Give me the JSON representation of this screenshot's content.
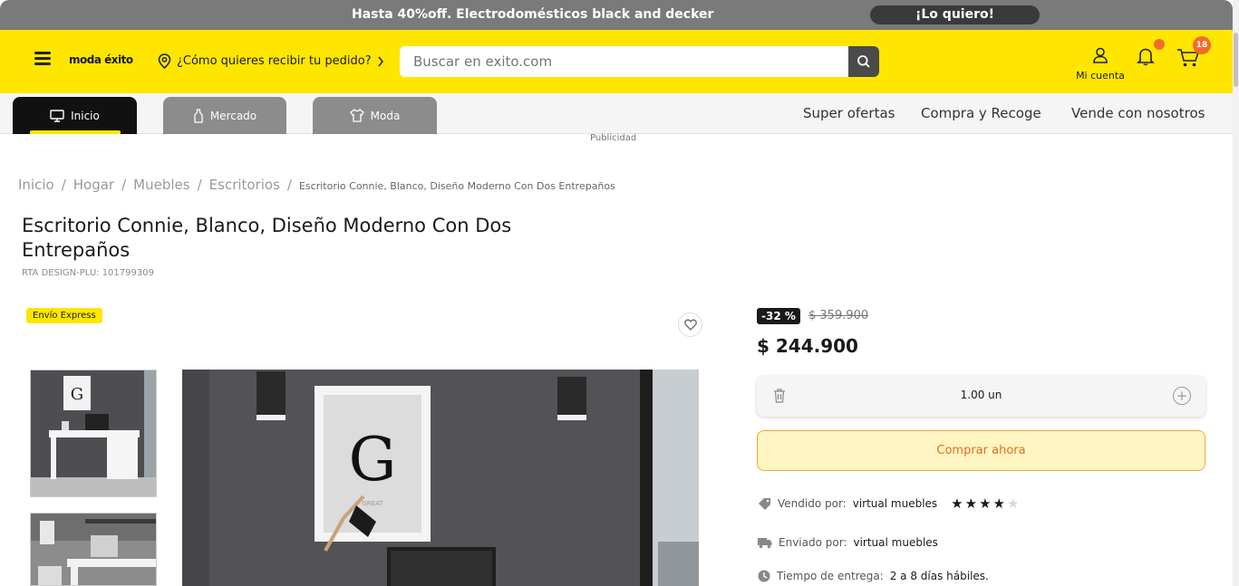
{
  "promo": {
    "text": "Hasta 40%off. Electrodomésticos black and decker",
    "cta": "¡Lo quiero!"
  },
  "header": {
    "logo": "moda éxito",
    "location_prompt": "¿Cómo quieres recibir tu pedido?",
    "search_placeholder": "Buscar en exito.com",
    "account_label": "Mi cuenta",
    "cart_count": "18"
  },
  "tabs": [
    {
      "label": "Inicio",
      "icon": "monitor-icon",
      "active": true
    },
    {
      "label": "Mercado",
      "icon": "bottle-icon",
      "active": false
    },
    {
      "label": "Moda",
      "icon": "shirt-icon",
      "active": false
    }
  ],
  "top_nav": [
    "Super ofertas",
    "Compra y Recoge",
    "Vende con nosotros"
  ],
  "ad_label": "Publicidad",
  "breadcrumb": [
    "Inicio",
    "Hogar",
    "Muebles",
    "Escritorios"
  ],
  "breadcrumb_current": "Escritorio Connie, Blanco, Diseño Moderno Con Dos Entrepaños",
  "product": {
    "title": "Escritorio Connie, Blanco, Diseño Moderno Con Dos Entrepaños",
    "sku": "RTA DESIGN-PLU: 101799309",
    "shipping_badge": "Envío Express",
    "discount": "-32 %",
    "old_price": "$ 359.900",
    "price": "$ 244.900",
    "quantity": "1.00 un",
    "buy_label": "Comprar ahora",
    "rating": 4,
    "rating_max": 5,
    "sold_by_label": "Vendido por:",
    "sold_by": "virtual muebles",
    "shipped_by_label": "Enviado por:",
    "shipped_by": "virtual muebles",
    "delivery_label": "Tiempo de entrega:",
    "delivery": "2 a 8 días hábiles."
  },
  "colors": {
    "brand_yellow": "#ffe600",
    "accent_orange": "#f36b2b",
    "dark": "#1a1a1a"
  }
}
